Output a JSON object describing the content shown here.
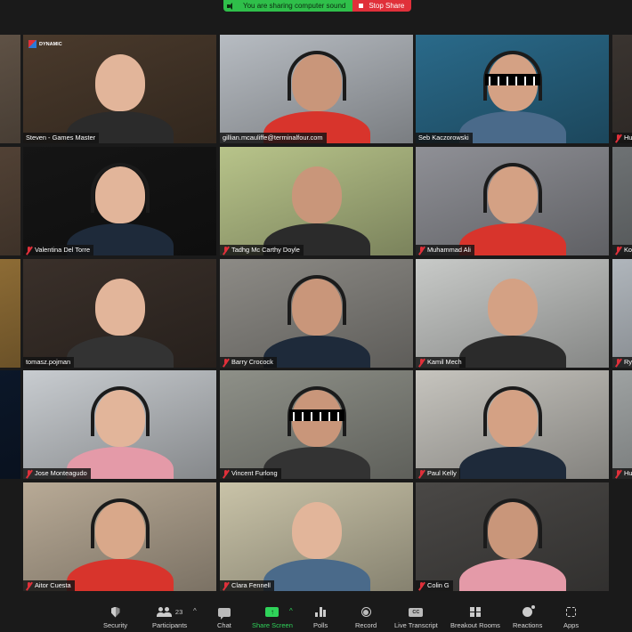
{
  "banner": {
    "sharing_text": "You are sharing computer sound",
    "stop_label": "Stop Share",
    "colors": {
      "sharing": "#2fbf4a",
      "stop": "#e0303a"
    }
  },
  "gallery": {
    "active_speaker_color": "#c9e06b",
    "muted_icon_color": "#e0303a",
    "tiles": [
      {
        "name": "",
        "muted": false,
        "row": 0,
        "col": 0,
        "active": true,
        "bg": "#6b5c4e"
      },
      {
        "name": "Steven - Games Master",
        "muted": false,
        "row": 0,
        "col": 1,
        "bg": "#4a3a2c",
        "logo": "DYNAMIC"
      },
      {
        "name": "gillian.mcauliffe@terminalfour.com",
        "muted": false,
        "row": 0,
        "col": 2,
        "bg": "#b7bcc2"
      },
      {
        "name": "Seb Kaczorowski",
        "muted": false,
        "row": 0,
        "col": 3,
        "bg": "#2a6a8a",
        "glasses": true
      },
      {
        "name": "Hu",
        "muted": true,
        "row": 0,
        "col": 4,
        "bg": "#3a3430"
      },
      {
        "name": "",
        "muted": false,
        "row": 1,
        "col": 0,
        "bg": "#5c4a3c"
      },
      {
        "name": "Valentina Del Torre",
        "muted": true,
        "row": 1,
        "col": 1,
        "bg": "#151515"
      },
      {
        "name": "Tadhg Mc Carthy Doyle",
        "muted": true,
        "row": 1,
        "col": 2,
        "bg": "#b8c48a"
      },
      {
        "name": "Muhammad Ali",
        "muted": true,
        "row": 1,
        "col": 3,
        "bg": "#8f9096"
      },
      {
        "name": "Ko",
        "muted": true,
        "row": 1,
        "col": 4,
        "bg": "#6e7274"
      },
      {
        "name": "",
        "muted": false,
        "row": 2,
        "col": 0,
        "bg": "#a07a3c"
      },
      {
        "name": "tomasz.pojman",
        "muted": false,
        "row": 2,
        "col": 1,
        "bg": "#3a302a"
      },
      {
        "name": "Barry Crocock",
        "muted": true,
        "row": 2,
        "col": 2,
        "bg": "#8d8b86"
      },
      {
        "name": "Kamil Mech",
        "muted": true,
        "row": 2,
        "col": 3,
        "bg": "#c8cac8"
      },
      {
        "name": "Ry",
        "muted": true,
        "row": 2,
        "col": 4,
        "bg": "#b0b6bc"
      },
      {
        "name": "",
        "muted": false,
        "row": 3,
        "col": 0,
        "bg": "#0d1a2e"
      },
      {
        "name": "Jose Monteagudo",
        "muted": true,
        "row": 3,
        "col": 1,
        "bg": "#c8ccd0"
      },
      {
        "name": "Vincent Furlong",
        "muted": true,
        "row": 3,
        "col": 2,
        "bg": "#8e9088",
        "glasses": true
      },
      {
        "name": "Paul Kelly",
        "muted": true,
        "row": 3,
        "col": 3,
        "bg": "#c6c4be"
      },
      {
        "name": "Hu",
        "muted": true,
        "row": 3,
        "col": 4,
        "bg": "#9ea2a2"
      },
      {
        "name": "Aitor Cuesta",
        "muted": true,
        "row": 4,
        "col": 1,
        "bg": "#b8aa96"
      },
      {
        "name": "Clara Fennell",
        "muted": true,
        "row": 4,
        "col": 2,
        "bg": "#c9c3a8"
      },
      {
        "name": "Colin G",
        "muted": true,
        "row": 4,
        "col": 3,
        "bg": "#4a4846"
      }
    ]
  },
  "toolbar": {
    "items": [
      {
        "id": "security",
        "label": "Security"
      },
      {
        "id": "participants",
        "label": "Participants",
        "count": "23"
      },
      {
        "id": "chat",
        "label": "Chat"
      },
      {
        "id": "share-screen",
        "label": "Share Screen",
        "active_color": "#2fd35a"
      },
      {
        "id": "polls",
        "label": "Polls"
      },
      {
        "id": "record",
        "label": "Record"
      },
      {
        "id": "live-transcript",
        "label": "Live Transcript",
        "icon_text": "CC"
      },
      {
        "id": "breakout-rooms",
        "label": "Breakout Rooms"
      },
      {
        "id": "reactions",
        "label": "Reactions"
      },
      {
        "id": "apps",
        "label": "Apps"
      }
    ]
  }
}
